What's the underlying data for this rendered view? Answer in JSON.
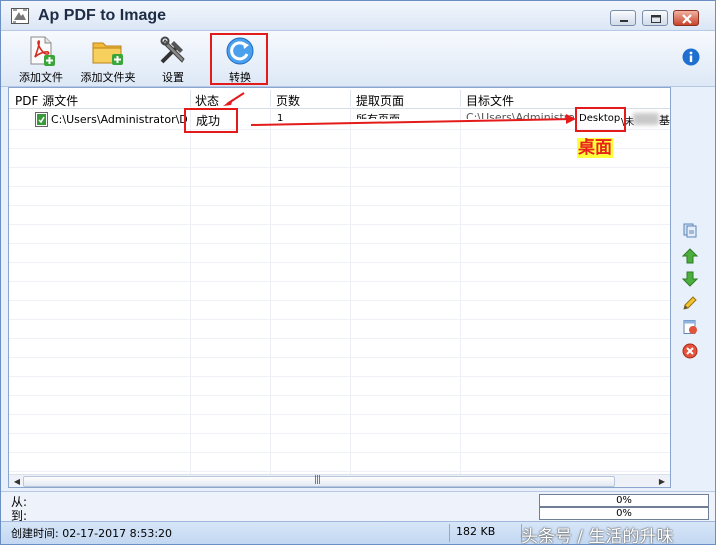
{
  "window": {
    "title": "Ap PDF to Image"
  },
  "toolbar": {
    "add_file": "添加文件",
    "add_folder": "添加文件夹",
    "settings": "设置",
    "convert": "转换"
  },
  "table": {
    "columns": [
      "PDF 源文件",
      "状态",
      "页数",
      "提取页面",
      "目标文件"
    ],
    "rows": [
      {
        "source": "C:\\Users\\Administrator\\D...",
        "status": "成功",
        "pages": "1",
        "extract_pages": "所有页面",
        "target_prefix": "C:\\Users\\Administrat...\\",
        "target_highlight": "Desktop",
        "target_suffix": "\\未",
        "target_end": "基"
      }
    ]
  },
  "progress": {
    "from_label": "从:",
    "to_label": "到:",
    "from_value": "0%",
    "to_value": "0%",
    "from_fraction": 0,
    "to_fraction": 0
  },
  "status": {
    "created": "创建时间: 02-17-2017 8:53:20",
    "size": "182 KB"
  },
  "watermark": {
    "text": "头条号 / 生活的升味"
  },
  "annotation": {
    "label": "桌面"
  },
  "colors": {
    "annotation_red": "#e31b1b",
    "highlight_yellow": "#ffff3c",
    "accent_blue": "#1a73d9"
  }
}
